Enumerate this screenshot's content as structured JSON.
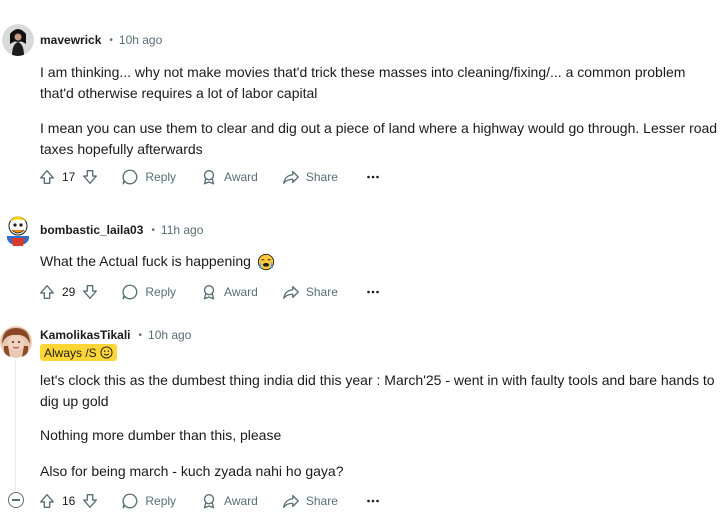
{
  "comments": [
    {
      "username": "mavewrick",
      "time": "10h ago",
      "paragraphs": [
        "I am thinking... why not make movies that'd trick these masses into cleaning/fixing/... a common problem that'd otherwise requires a lot of labor capital",
        "I mean you can use them to clear and dig out a piece of land where a highway would go through. Lesser road taxes hopefully afterwards"
      ],
      "votes": "17"
    },
    {
      "username": "bombastic_laila03",
      "time": "11h ago",
      "paragraphs": [
        "What the Actual fuck is happening"
      ],
      "votes": "29"
    },
    {
      "username": "KamolikasTikali",
      "time": "10h ago",
      "flair": "Always /S",
      "paragraphs": [
        "let's clock this as the dumbest thing india did this year : March'25 - went in with faulty tools and bare hands to dig up gold",
        "Nothing more dumber than this, please",
        "Also for being march - kuch zyada nahi ho gaya?"
      ],
      "votes": "16"
    }
  ],
  "actions": {
    "reply": "Reply",
    "award": "Award",
    "share": "Share",
    "more": "···"
  },
  "icons": {
    "upvote": "arrow-up-icon",
    "downvote": "arrow-down-icon",
    "reply": "speech-bubble-icon",
    "award": "award-ribbon-icon",
    "share": "share-arrow-icon",
    "more": "more-dots-icon",
    "collapse": "minus-circle-icon",
    "emoji": "crying-face-emoji",
    "flair_emoji": "smile-face-emoji"
  },
  "colors": {
    "meta": "#576f76",
    "flair_bg": "#ffd635",
    "thread_line": "#e5ebee"
  }
}
